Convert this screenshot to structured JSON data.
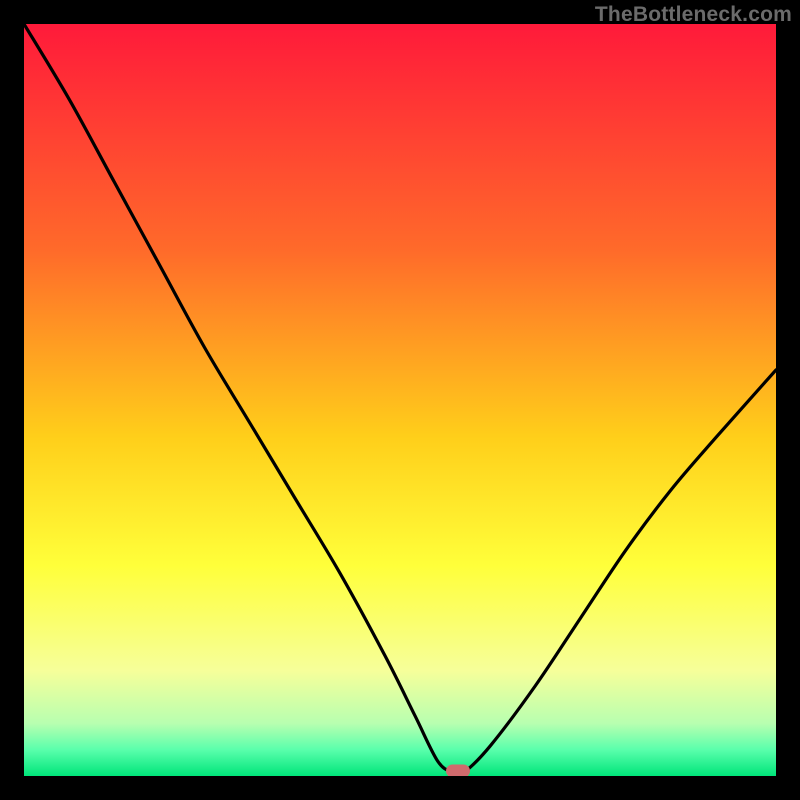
{
  "watermark": "TheBottleneck.com",
  "colors": {
    "frame": "#000000",
    "marker": "#cf6a6d",
    "grad_top": "#ff1a3a",
    "grad_mid1": "#ff8a1f",
    "grad_mid2": "#ffe61a",
    "grad_mid3": "#f6ff6e",
    "grad_mid4": "#b8ffb0",
    "grad_bottom": "#00e57a",
    "curve": "#000000"
  },
  "chart_data": {
    "type": "line",
    "title": "",
    "xlabel": "",
    "ylabel": "",
    "xlim": [
      0,
      100
    ],
    "ylim": [
      0,
      100
    ],
    "series": [
      {
        "name": "bottleneck-curve",
        "x": [
          0,
          6,
          12,
          18,
          24,
          30,
          36,
          42,
          48,
          52,
          55,
          57,
          58.5,
          62,
          68,
          74,
          80,
          86,
          92,
          100
        ],
        "values": [
          100,
          90,
          79,
          68,
          57,
          47,
          37,
          27,
          16,
          8,
          2,
          0.5,
          0.5,
          4,
          12,
          21,
          30,
          38,
          45,
          54
        ]
      }
    ],
    "marker": {
      "x": 57.7,
      "y": 0.6
    },
    "gradient_stops": [
      {
        "pos": 0.0,
        "color": "#ff1a3a"
      },
      {
        "pos": 0.3,
        "color": "#ff6a2a"
      },
      {
        "pos": 0.55,
        "color": "#ffcf1a"
      },
      {
        "pos": 0.72,
        "color": "#ffff3a"
      },
      {
        "pos": 0.86,
        "color": "#f6ff9a"
      },
      {
        "pos": 0.93,
        "color": "#b8ffb0"
      },
      {
        "pos": 0.965,
        "color": "#5affac"
      },
      {
        "pos": 1.0,
        "color": "#00e57a"
      }
    ]
  }
}
